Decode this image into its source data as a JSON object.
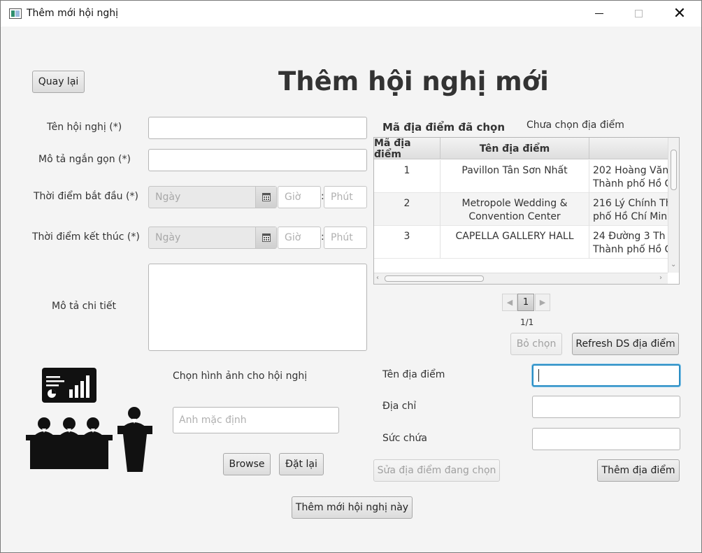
{
  "window": {
    "title": "Thêm mới hội nghị"
  },
  "header": {
    "back_label": "Quay lại",
    "title": "Thêm hội nghị mới"
  },
  "form": {
    "name_label": "Tên hội nghị (*)",
    "name_value": "",
    "short_desc_label": "Mô tả ngắn gọn (*)",
    "short_desc_value": "",
    "start_label": "Thời điểm bắt đầu (*)",
    "end_label": "Thời điểm kết thúc (*)",
    "date_placeholder": "Ngày",
    "hour_placeholder": "Giờ",
    "minute_placeholder": "Phút",
    "colon": ":",
    "detail_desc_label": "Mô tả chi tiết",
    "detail_desc_value": ""
  },
  "image": {
    "label": "Chọn hình ảnh cho hội nghị",
    "placeholder": "Ảnh mặc định",
    "browse_label": "Browse",
    "reset_label": "Đặt lại"
  },
  "location": {
    "selected_label": "Mã địa điểm đã chọn",
    "selected_value": "Chưa chọn địa điểm",
    "columns": [
      "Mã địa điểm",
      "Tên địa điểm",
      ""
    ],
    "rows": [
      {
        "id": "1",
        "name": "Pavillon Tân Sơn Nhất",
        "addr_line1": "202  Hoàng  Văn",
        "addr_line2": "Thành phố Hồ C"
      },
      {
        "id": "2",
        "name": "Metropole Wedding & Convention Center",
        "addr_line1": "216  Lý  Chính  Th",
        "addr_line2": "phố Hồ Chí Minh"
      },
      {
        "id": "3",
        "name": "CAPELLA GALLERY HALL",
        "addr_line1": "24  Đường  3  Th",
        "addr_line2": "Thành phố Hồ C"
      }
    ],
    "page_current": "1",
    "page_info": "1/1",
    "deselect_label": "Bỏ chọn",
    "refresh_label": "Refresh DS địa điểm",
    "name_label": "Tên địa điểm",
    "name_value": "",
    "address_label": "Địa chỉ",
    "address_value": "",
    "capacity_label": "Sức chứa",
    "capacity_value": "",
    "edit_label": "Sửa địa điểm đang chọn",
    "add_label": "Thêm địa điểm"
  },
  "submit_label": "Thêm mới hội nghị này",
  "icons": {
    "app": "app-window-icon",
    "calendar": "calendar-icon",
    "illustration": "conference-illustration"
  }
}
